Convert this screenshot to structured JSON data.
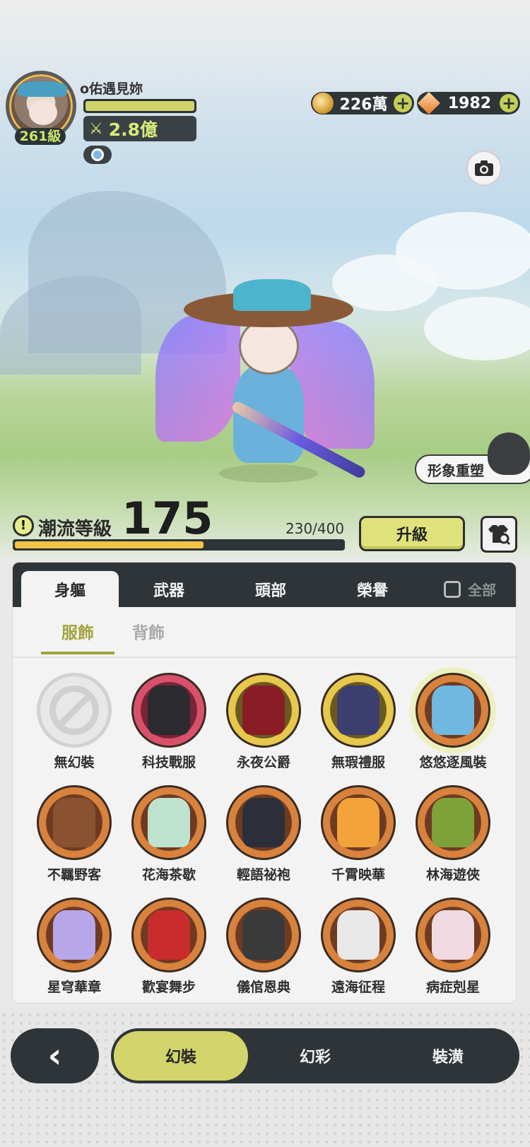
{
  "player": {
    "name": "o佑遇見妳",
    "level": "261級",
    "power": "2.8億",
    "exp_fraction": 1.0
  },
  "currencies": [
    {
      "icon": "coin-icon",
      "value": "226萬"
    },
    {
      "icon": "gem-icon",
      "value": "1982"
    }
  ],
  "scene": {
    "reshape_button": "形象重塑"
  },
  "trend": {
    "label": "潮流等級",
    "level": "175",
    "progress_text": "230/400",
    "progress_fraction": 0.575,
    "upgrade_button": "升級"
  },
  "tabs": {
    "items": [
      "身軀",
      "武器",
      "頭部",
      "榮譽"
    ],
    "active": "身軀",
    "all_label": "全部"
  },
  "subtabs": {
    "items": [
      "服飾",
      "背飾"
    ],
    "active": "服飾"
  },
  "outfits": [
    {
      "name": "無幻裝",
      "frame": "none"
    },
    {
      "name": "科技戰服",
      "frame": "red",
      "color": "#2b2b30"
    },
    {
      "name": "永夜公爵",
      "frame": "gold",
      "color": "#8a1c26"
    },
    {
      "name": "無瑕禮服",
      "frame": "gold",
      "color": "#3b3e6e"
    },
    {
      "name": "悠悠逐風裝",
      "frame": "orange",
      "color": "#6fb8e0",
      "selected": true
    },
    {
      "name": "不羈野客",
      "frame": "orange",
      "color": "#8a5230"
    },
    {
      "name": "花海茶歇",
      "frame": "orange",
      "color": "#bfe2cf"
    },
    {
      "name": "輕語祕袍",
      "frame": "orange",
      "color": "#2c2f3a"
    },
    {
      "name": "千霄映華",
      "frame": "orange",
      "color": "#f2a33a"
    },
    {
      "name": "林海遊俠",
      "frame": "orange",
      "color": "#7fa13a"
    },
    {
      "name": "星穹華章",
      "frame": "orange",
      "color": "#b7a6e8"
    },
    {
      "name": "歡宴舞步",
      "frame": "orange",
      "color": "#c92c2c"
    },
    {
      "name": "儀倌恩典",
      "frame": "orange",
      "color": "#3a3a3a"
    },
    {
      "name": "遠海征程",
      "frame": "orange",
      "color": "#e8e8e8"
    },
    {
      "name": "病症剋星",
      "frame": "orange",
      "color": "#f1d9e1"
    }
  ],
  "bottom_nav": {
    "back_icon": "back-chevron-icon",
    "modes": [
      "幻裝",
      "幻彩",
      "裝潢"
    ],
    "active": "幻裝"
  },
  "colors": {
    "accent": "#d3d46c",
    "dark": "#2e3437",
    "subtab_active": "#a2a43b"
  }
}
